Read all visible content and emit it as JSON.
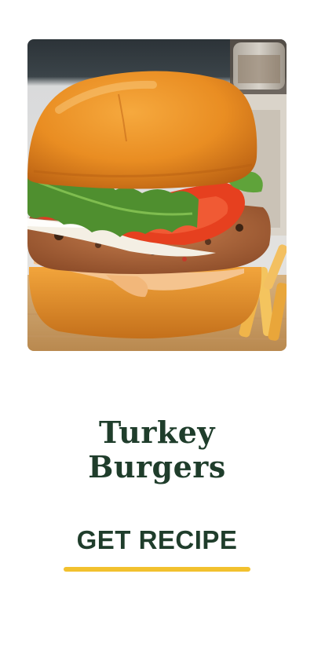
{
  "recipe_card": {
    "image_alt": "Turkey burger with lettuce, tomato and onion on a brioche bun",
    "title_line1": "Turkey",
    "title_line2": "Burgers",
    "cta_label": "GET RECIPE"
  },
  "colors": {
    "title": "#1f3d2b",
    "cta_text": "#1f3d2b",
    "cta_underline": "#f2c12e",
    "background": "#ffffff"
  }
}
